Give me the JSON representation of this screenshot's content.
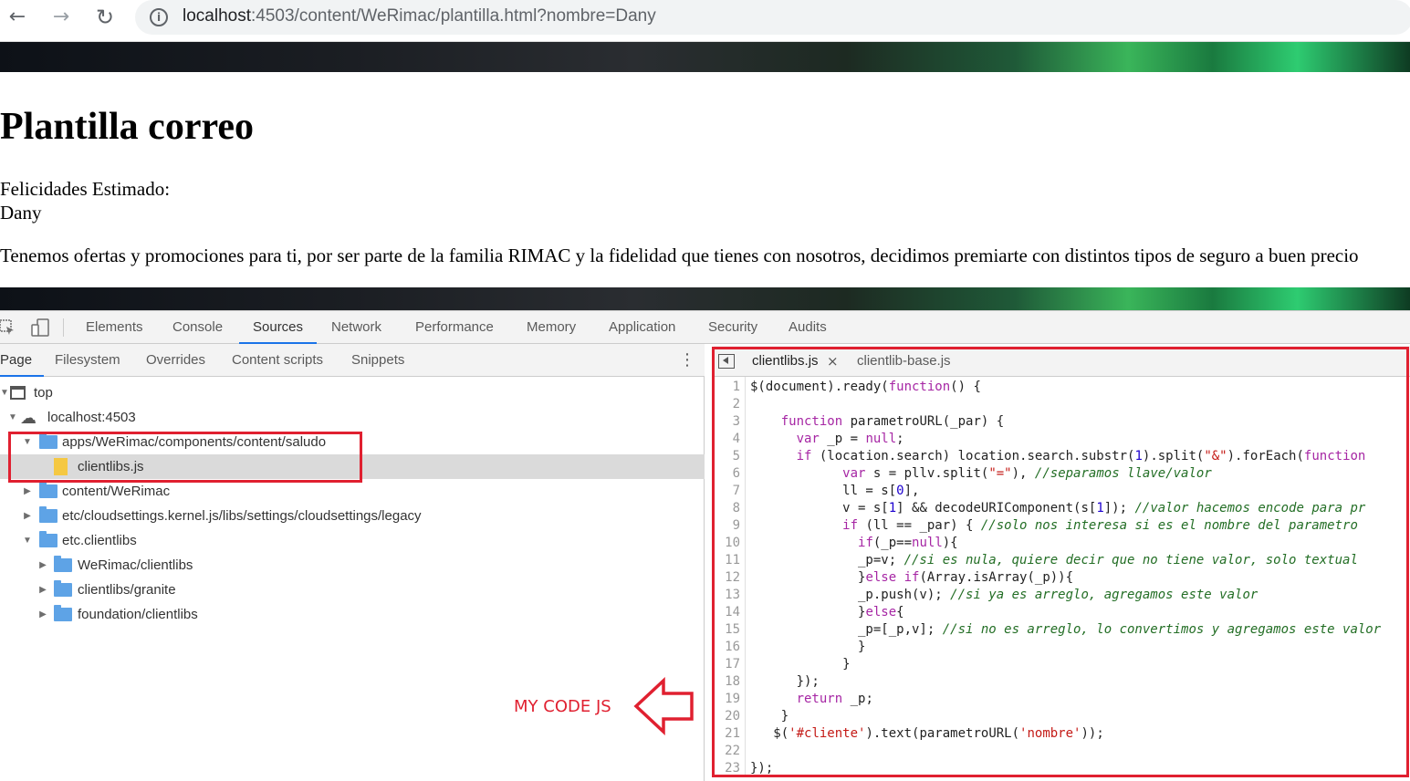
{
  "browser": {
    "url_host": "localhost",
    "url_rest": ":4503/content/WeRimac/plantilla.html?nombre=Dany"
  },
  "page": {
    "title": "Plantilla correo",
    "line1": "Felicidades Estimado:",
    "line2": "Dany",
    "paragraph": "Tenemos ofertas y promociones para ti, por ser parte de la familia RIMAC y la fidelidad que tienes con nosotros, decidimos premiarte con distintos tipos de seguro a buen precio"
  },
  "devtools": {
    "tabs": [
      "Elements",
      "Console",
      "Sources",
      "Network",
      "Performance",
      "Memory",
      "Application",
      "Security",
      "Audits"
    ],
    "active_tab": "Sources",
    "navigator_tabs": [
      "Page",
      "Filesystem",
      "Overrides",
      "Content scripts",
      "Snippets"
    ],
    "tree": [
      {
        "label": "top"
      },
      {
        "label": "localhost:4503"
      },
      {
        "label": "apps/WeRimac/components/content/saludo"
      },
      {
        "label": "clientlibs.js"
      },
      {
        "label": "content/WeRimac"
      },
      {
        "label": "etc/cloudsettings.kernel.js/libs/settings/cloudsettings/legacy"
      },
      {
        "label": "etc.clientlibs"
      },
      {
        "label": "WeRimac/clientlibs"
      },
      {
        "label": "clientlibs/granite"
      },
      {
        "label": "foundation/clientlibs"
      }
    ],
    "editor_tabs": [
      "clientlibs.js",
      "clientlib-base.js"
    ],
    "close_glyph": "×",
    "line_numbers": [
      "1",
      "2",
      "3",
      "4",
      "5",
      "6",
      "7",
      "8",
      "9",
      "10",
      "11",
      "12",
      "13",
      "14",
      "15",
      "16",
      "17",
      "18",
      "19",
      "20",
      "21",
      "22",
      "23"
    ]
  },
  "annotation": {
    "label": "MY CODE JS",
    "color": "#e02030"
  },
  "colors": {
    "accent": "#1a73e8",
    "folder": "#5ea3e6",
    "file": "#f5c842"
  }
}
